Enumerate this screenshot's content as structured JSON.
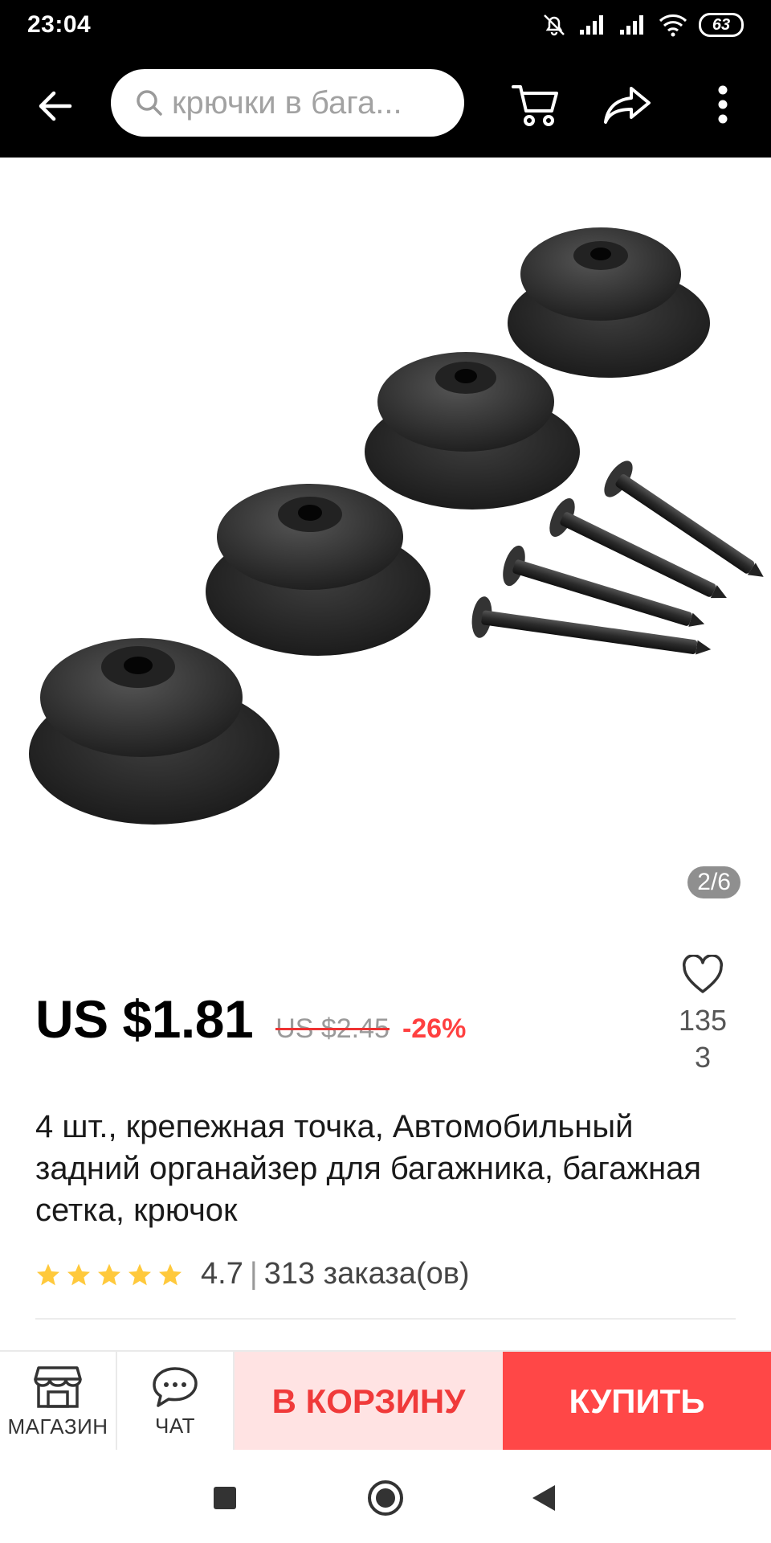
{
  "status_bar": {
    "time": "23:04",
    "battery": "63",
    "icons": [
      "mute-icon",
      "signal-icon",
      "signal-icon",
      "wifi-icon",
      "battery-icon"
    ]
  },
  "app_bar": {
    "search_placeholder": "крючки в бага...",
    "icons": [
      "back-arrow-icon",
      "search-icon",
      "cart-icon",
      "share-icon",
      "more-icon"
    ]
  },
  "gallery": {
    "counter": "2/6"
  },
  "product": {
    "price": "US $1.81",
    "old_price": "US $2.45",
    "discount": "-26%",
    "wishlist_count": "1353",
    "title": "4 шт., крепежная точка, Автомобильный задний органайзер для багажника, багажная сетка, крючок",
    "rating": "4.7",
    "orders": "313 заказа(ов)",
    "rating_separator": "|",
    "stars_filled": 5
  },
  "actions": {
    "store_label": "МАГАЗИН",
    "chat_label": "ЧАТ",
    "add_to_cart_label": "В КОРЗИНУ",
    "buy_label": "КУПИТЬ"
  },
  "colors": {
    "accent": "#ff4747",
    "accent_light": "#ffe3e3",
    "star": "#ffc93c"
  }
}
